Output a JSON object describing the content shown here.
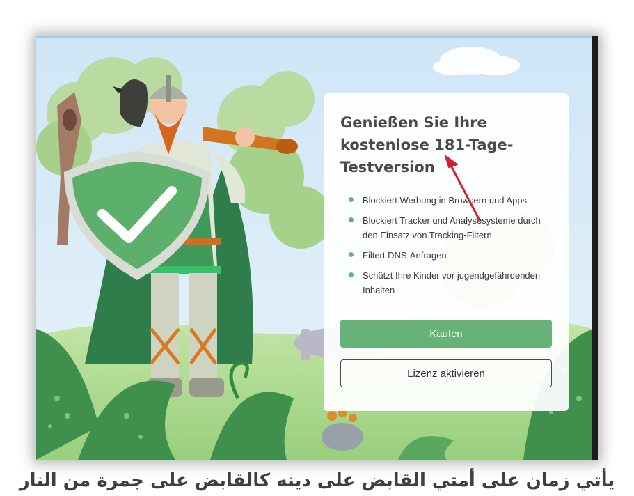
{
  "card": {
    "title_line1": "Genießen Sie Ihre",
    "title_line2": "kostenlose 181-Tage-",
    "title_line3": "Testversion",
    "features": [
      {
        "text": "Blockiert Werbung in Browsern und Apps"
      },
      {
        "text": "Blockiert Tracker und Analysesysteme durch den Einsatz von Tracking-Filtern"
      },
      {
        "text": "Filtert DNS-Anfragen"
      },
      {
        "text": "Schützt Ihre Kinder vor jugendgefährdenden Inhalten"
      }
    ],
    "buy_label": "Kaufen",
    "activate_label": "Lizenz aktivieren"
  },
  "caption": "يأتي زمان على أمتي القابض على دينه كالقابض على جمرة من النار",
  "colors": {
    "accent_green": "#67b279",
    "annotation_arrow": "#d3202a",
    "sky": "#cfe6f7"
  },
  "illustration": {
    "subject": "viking-with-shield-illustration",
    "shield_icon": "checkmark-shield-icon"
  }
}
